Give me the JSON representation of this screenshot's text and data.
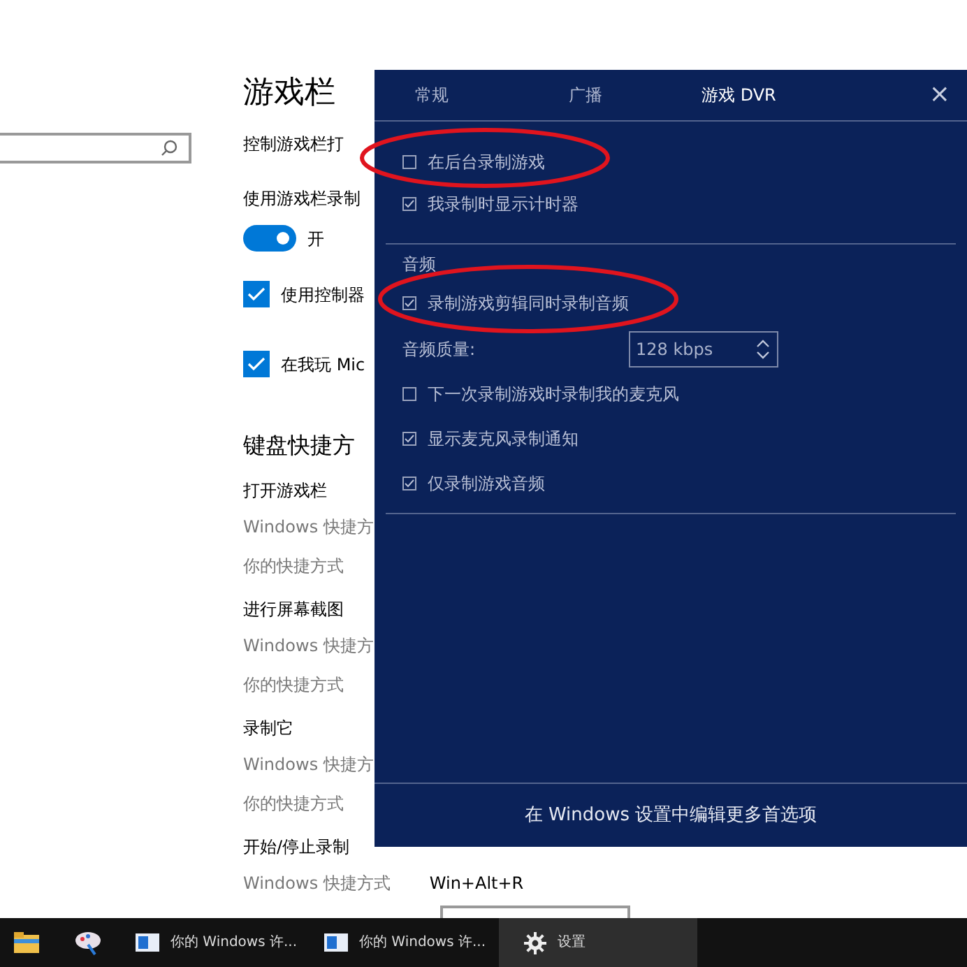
{
  "settings_page": {
    "title": "游戏栏",
    "items": [
      {
        "kind": "label",
        "text": "控制游戏栏打"
      },
      {
        "kind": "label",
        "text": "使用游戏栏录制"
      },
      {
        "kind": "toggle",
        "text": "开",
        "on": true
      },
      {
        "kind": "checkbox",
        "text": "使用控制器",
        "checked": true
      },
      {
        "kind": "checkbox",
        "text": "在我玩 Mic",
        "checked": true
      },
      {
        "kind": "heading",
        "text": "键盘快捷方"
      },
      {
        "kind": "label",
        "text": "打开游戏栏"
      },
      {
        "kind": "sublabel",
        "text": "Windows 快捷方"
      },
      {
        "kind": "sublabel",
        "text": "你的快捷方式"
      },
      {
        "kind": "label",
        "text": "进行屏幕截图"
      },
      {
        "kind": "sublabel",
        "text": "Windows 快捷方"
      },
      {
        "kind": "sublabel",
        "text": "你的快捷方式"
      },
      {
        "kind": "label",
        "text": "录制它"
      },
      {
        "kind": "sublabel",
        "text": "Windows 快捷方"
      },
      {
        "kind": "sublabel",
        "text": "你的快捷方式"
      },
      {
        "kind": "label",
        "text": "开始/停止录制"
      },
      {
        "kind": "shortcut",
        "text": "Windows 快捷方式",
        "value": "Win+Alt+R"
      },
      {
        "kind": "field"
      }
    ]
  },
  "dialog": {
    "tabs": [
      {
        "label": "常规",
        "selected": false
      },
      {
        "label": "广播",
        "selected": false
      },
      {
        "label": "游戏 DVR",
        "selected": true
      }
    ],
    "close": "×",
    "items": [
      {
        "kind": "checkbox",
        "text": "在后台录制游戏",
        "checked": false
      },
      {
        "kind": "checkbox",
        "text": "我录制时显示计时器",
        "checked": true
      },
      {
        "kind": "divider"
      },
      {
        "kind": "section",
        "text": "音频"
      },
      {
        "kind": "checkbox",
        "text": "录制游戏剪辑同时录制音频",
        "checked": true
      },
      {
        "kind": "select",
        "text": "音频质量:",
        "value": "128 kbps"
      },
      {
        "kind": "checkbox",
        "text": "下一次录制游戏时录制我的麦克风",
        "checked": false
      },
      {
        "kind": "checkbox",
        "text": "显示麦克风录制通知",
        "checked": true
      },
      {
        "kind": "checkbox",
        "text": "仅录制游戏音频",
        "checked": true
      },
      {
        "kind": "divider"
      }
    ],
    "footer": "在 Windows 设置中编辑更多首选项"
  },
  "taskbar": {
    "items": [
      {
        "kind": "folder"
      },
      {
        "kind": "paint"
      },
      {
        "kind": "window",
        "label": "你的 Windows 许...",
        "selected": false
      },
      {
        "kind": "window",
        "label": "你的 Windows 许...",
        "selected": false
      },
      {
        "kind": "settings",
        "label": "设置",
        "selected": true
      }
    ]
  }
}
